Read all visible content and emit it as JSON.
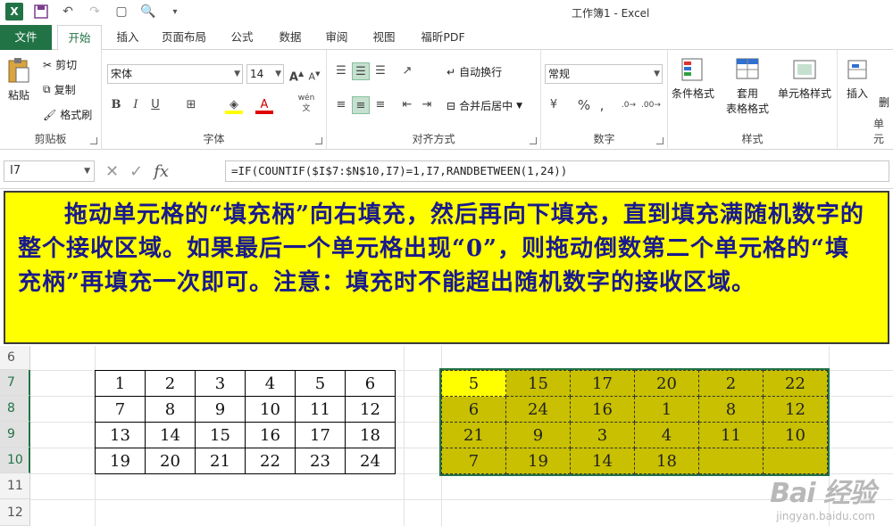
{
  "app": {
    "window_title": "工作簿1 - Excel"
  },
  "tabs": [
    "文件",
    "开始",
    "插入",
    "页面布局",
    "公式",
    "数据",
    "审阅",
    "视图",
    "福昕PDF"
  ],
  "ribbon": {
    "clipboard": {
      "label": "剪贴板",
      "paste": "粘贴",
      "cut": "剪切",
      "copy": "复制",
      "format_painter": "格式刷"
    },
    "font": {
      "label": "字体",
      "font_name": "宋体",
      "font_size": "14",
      "bold": "B",
      "italic": "I",
      "underline": "U",
      "wen": "wén 文"
    },
    "alignment": {
      "label": "对齐方式",
      "wrap": "自动换行",
      "merge": "合并后居中"
    },
    "number": {
      "label": "数字",
      "format": "常规",
      "percent": "%",
      "comma": ","
    },
    "styles": {
      "label": "样式",
      "conditional": "条件格式",
      "table": "套用\n表格格式",
      "table_line1": "套用",
      "table_line2": "表格格式",
      "cell_styles": "单元格样式"
    },
    "cells": {
      "insert": "插入",
      "partial": "单元",
      "partial_top": "删"
    }
  },
  "formula_bar": {
    "name_box": "I7",
    "fx": "fx",
    "formula": "=IF(COUNTIF($I$7:$N$10,I7)=1,I7,RANDBETWEEN(1,24))"
  },
  "note": {
    "text": "拖动单元格的“填充柄”向右填充，然后再向下填充，直到填充满随机数字的整个接收区域。如果最后一个单元格出现“0”，则拖动倒数第二个单元格的“填充柄”再填充一次即可。注意：填充时不能超出随机数字的接收区域。"
  },
  "row_headers": [
    "6",
    "7",
    "8",
    "9",
    "10",
    "11",
    "12"
  ],
  "table_left": [
    [
      "1",
      "2",
      "3",
      "4",
      "5",
      "6"
    ],
    [
      "7",
      "8",
      "9",
      "10",
      "11",
      "12"
    ],
    [
      "13",
      "14",
      "15",
      "16",
      "17",
      "18"
    ],
    [
      "19",
      "20",
      "21",
      "22",
      "23",
      "24"
    ]
  ],
  "table_right": [
    [
      "5",
      "15",
      "17",
      "20",
      "2",
      "22"
    ],
    [
      "6",
      "24",
      "16",
      "1",
      "8",
      "12"
    ],
    [
      "21",
      "9",
      "3",
      "4",
      "11",
      "10"
    ],
    [
      "7",
      "19",
      "14",
      "18",
      "",
      ""
    ]
  ],
  "watermark": {
    "brand": "Bai  经验",
    "url": "jingyan.baidu.com"
  },
  "colors": {
    "excel_green": "#217346",
    "note_bg": "#ffff00",
    "note_text": "#1a1a8c",
    "range_fill": "#c8c000"
  }
}
